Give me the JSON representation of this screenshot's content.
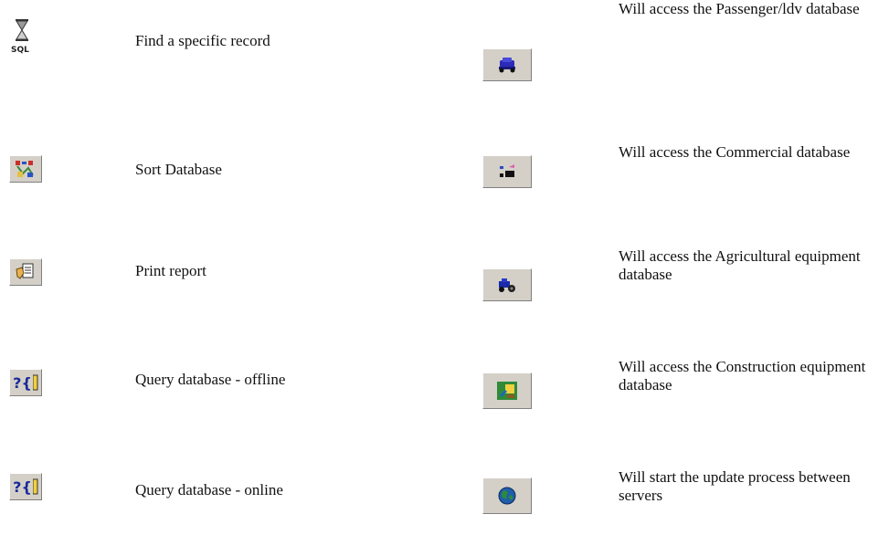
{
  "left": {
    "items": [
      {
        "label": "Find a specific record",
        "icon": "sql-hourglass-icon"
      },
      {
        "label": "Sort Database",
        "icon": "sort-database-icon"
      },
      {
        "label": "Print report",
        "icon": "print-report-icon"
      },
      {
        "label": "Query database - offline",
        "icon": "query-offline-icon"
      },
      {
        "label": "Query database - online",
        "icon": "query-online-icon"
      }
    ]
  },
  "right": {
    "items": [
      {
        "label": " Will access the Passenger/ldv database",
        "icon": "passenger-car-icon"
      },
      {
        "label": "Will access the Commercial database",
        "icon": "commercial-truck-icon"
      },
      {
        "label": "Will access the Agricultural equipment database",
        "icon": "agricultural-tractor-icon"
      },
      {
        "label": "Will access the Construction equipment database",
        "icon": "construction-equipment-icon"
      },
      {
        "label": "Will start the update process between servers",
        "icon": "globe-update-icon"
      }
    ]
  },
  "icon_text": {
    "sql": "SQL",
    "query_offline": "?{",
    "query_online": "?{"
  },
  "colors": {
    "button_face": "#d4d0c8",
    "button_highlight": "#ffffff",
    "button_shadow": "#808080",
    "car_blue": "#2b2bb8",
    "globe_blue": "#1f5fa8",
    "globe_green": "#2f8a3a"
  }
}
